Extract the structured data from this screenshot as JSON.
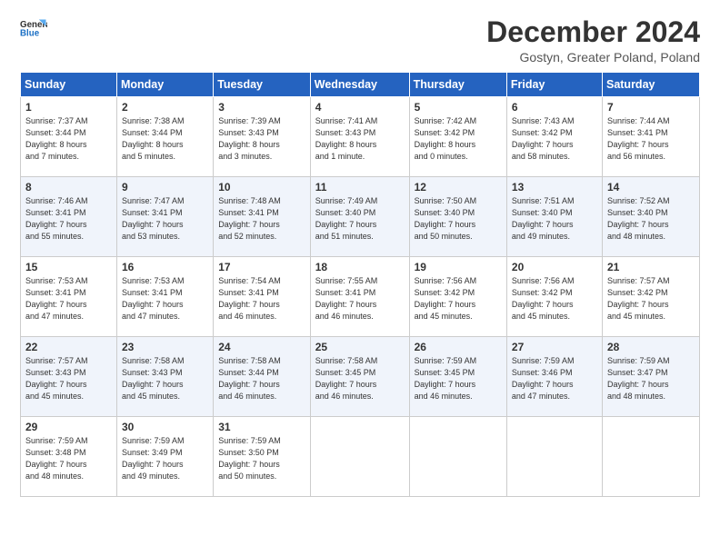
{
  "logo": {
    "line1": "General",
    "line2": "Blue"
  },
  "title": "December 2024",
  "subtitle": "Gostyn, Greater Poland, Poland",
  "days_header": [
    "Sunday",
    "Monday",
    "Tuesday",
    "Wednesday",
    "Thursday",
    "Friday",
    "Saturday"
  ],
  "weeks": [
    [
      {
        "day": "1",
        "info": "Sunrise: 7:37 AM\nSunset: 3:44 PM\nDaylight: 8 hours\nand 7 minutes."
      },
      {
        "day": "2",
        "info": "Sunrise: 7:38 AM\nSunset: 3:44 PM\nDaylight: 8 hours\nand 5 minutes."
      },
      {
        "day": "3",
        "info": "Sunrise: 7:39 AM\nSunset: 3:43 PM\nDaylight: 8 hours\nand 3 minutes."
      },
      {
        "day": "4",
        "info": "Sunrise: 7:41 AM\nSunset: 3:43 PM\nDaylight: 8 hours\nand 1 minute."
      },
      {
        "day": "5",
        "info": "Sunrise: 7:42 AM\nSunset: 3:42 PM\nDaylight: 8 hours\nand 0 minutes."
      },
      {
        "day": "6",
        "info": "Sunrise: 7:43 AM\nSunset: 3:42 PM\nDaylight: 7 hours\nand 58 minutes."
      },
      {
        "day": "7",
        "info": "Sunrise: 7:44 AM\nSunset: 3:41 PM\nDaylight: 7 hours\nand 56 minutes."
      }
    ],
    [
      {
        "day": "8",
        "info": "Sunrise: 7:46 AM\nSunset: 3:41 PM\nDaylight: 7 hours\nand 55 minutes."
      },
      {
        "day": "9",
        "info": "Sunrise: 7:47 AM\nSunset: 3:41 PM\nDaylight: 7 hours\nand 53 minutes."
      },
      {
        "day": "10",
        "info": "Sunrise: 7:48 AM\nSunset: 3:41 PM\nDaylight: 7 hours\nand 52 minutes."
      },
      {
        "day": "11",
        "info": "Sunrise: 7:49 AM\nSunset: 3:40 PM\nDaylight: 7 hours\nand 51 minutes."
      },
      {
        "day": "12",
        "info": "Sunrise: 7:50 AM\nSunset: 3:40 PM\nDaylight: 7 hours\nand 50 minutes."
      },
      {
        "day": "13",
        "info": "Sunrise: 7:51 AM\nSunset: 3:40 PM\nDaylight: 7 hours\nand 49 minutes."
      },
      {
        "day": "14",
        "info": "Sunrise: 7:52 AM\nSunset: 3:40 PM\nDaylight: 7 hours\nand 48 minutes."
      }
    ],
    [
      {
        "day": "15",
        "info": "Sunrise: 7:53 AM\nSunset: 3:41 PM\nDaylight: 7 hours\nand 47 minutes."
      },
      {
        "day": "16",
        "info": "Sunrise: 7:53 AM\nSunset: 3:41 PM\nDaylight: 7 hours\nand 47 minutes."
      },
      {
        "day": "17",
        "info": "Sunrise: 7:54 AM\nSunset: 3:41 PM\nDaylight: 7 hours\nand 46 minutes."
      },
      {
        "day": "18",
        "info": "Sunrise: 7:55 AM\nSunset: 3:41 PM\nDaylight: 7 hours\nand 46 minutes."
      },
      {
        "day": "19",
        "info": "Sunrise: 7:56 AM\nSunset: 3:42 PM\nDaylight: 7 hours\nand 45 minutes."
      },
      {
        "day": "20",
        "info": "Sunrise: 7:56 AM\nSunset: 3:42 PM\nDaylight: 7 hours\nand 45 minutes."
      },
      {
        "day": "21",
        "info": "Sunrise: 7:57 AM\nSunset: 3:42 PM\nDaylight: 7 hours\nand 45 minutes."
      }
    ],
    [
      {
        "day": "22",
        "info": "Sunrise: 7:57 AM\nSunset: 3:43 PM\nDaylight: 7 hours\nand 45 minutes."
      },
      {
        "day": "23",
        "info": "Sunrise: 7:58 AM\nSunset: 3:43 PM\nDaylight: 7 hours\nand 45 minutes."
      },
      {
        "day": "24",
        "info": "Sunrise: 7:58 AM\nSunset: 3:44 PM\nDaylight: 7 hours\nand 46 minutes."
      },
      {
        "day": "25",
        "info": "Sunrise: 7:58 AM\nSunset: 3:45 PM\nDaylight: 7 hours\nand 46 minutes."
      },
      {
        "day": "26",
        "info": "Sunrise: 7:59 AM\nSunset: 3:45 PM\nDaylight: 7 hours\nand 46 minutes."
      },
      {
        "day": "27",
        "info": "Sunrise: 7:59 AM\nSunset: 3:46 PM\nDaylight: 7 hours\nand 47 minutes."
      },
      {
        "day": "28",
        "info": "Sunrise: 7:59 AM\nSunset: 3:47 PM\nDaylight: 7 hours\nand 48 minutes."
      }
    ],
    [
      {
        "day": "29",
        "info": "Sunrise: 7:59 AM\nSunset: 3:48 PM\nDaylight: 7 hours\nand 48 minutes."
      },
      {
        "day": "30",
        "info": "Sunrise: 7:59 AM\nSunset: 3:49 PM\nDaylight: 7 hours\nand 49 minutes."
      },
      {
        "day": "31",
        "info": "Sunrise: 7:59 AM\nSunset: 3:50 PM\nDaylight: 7 hours\nand 50 minutes."
      },
      null,
      null,
      null,
      null
    ]
  ]
}
